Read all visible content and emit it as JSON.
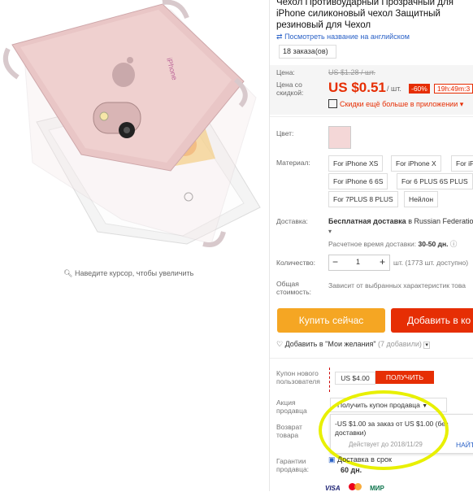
{
  "product": {
    "zoom_hint": "Наведите курсор, чтобы увеличить",
    "title": "Чехол Противоударный Прозрачный для iPhone силиконовый чехол Защитный резиновый для Чехол",
    "translate_link": "Посмотреть название на английском",
    "orders": "18 заказа(ов)"
  },
  "price": {
    "label_price": "Цена:",
    "label_discount_price": "Цена со скидкой:",
    "old_price": "US $1.28 / шт.",
    "current_price": "US $0.51",
    "unit": "/ шт.",
    "discount": "-60%",
    "timer": "19h:49m:3",
    "app_discount": "Скидки ещё больше в приложении"
  },
  "options": {
    "color_label": "Цвет:",
    "material_label": "Материал:",
    "materials": [
      "For iPhone XS",
      "For iPhone X",
      "For iP",
      "For iPhone 6 6S",
      "For 6 PLUS 6S PLUS",
      "For 7PLUS 8 PLUS",
      "Нейлон"
    ]
  },
  "shipping": {
    "label": "Доставка:",
    "free": "Бесплатная доставка",
    "to": "в Russian Federatio",
    "time_label": "Расчетное время доставки:",
    "time": "30-50 дн."
  },
  "quantity": {
    "label": "Количество:",
    "value": "1",
    "minus": "−",
    "plus": "+",
    "available": "шт. (1773 шт. доступно)"
  },
  "total": {
    "label": "Общая стоимость:",
    "value": "Зависит от выбранных характеристик това"
  },
  "actions": {
    "buy_now": "Купить сейчас",
    "add_cart": "Добавить в ко",
    "wishlist": "Добавить в \"Мои желания\"",
    "wishlist_count": "(7 добавили)"
  },
  "coupons": {
    "new_user_label": "Купон нового пользователя",
    "new_user_value": "US $4.00",
    "get_button": "ПОЛУЧИТЬ",
    "seller_label": "Акция продавца",
    "seller_dropdown": "Получить купон продавца",
    "coupon_text": "-US $1.00 за заказ от US $1.00 (без доставки)",
    "coupon_valid": "Действует до 2018/11/29",
    "coupon_find": "НАЙТ",
    "return_label": "Возврат товара"
  },
  "guarantee": {
    "label": "Гарантии продавца:",
    "value": "Доставка в срок",
    "days": "60 дн."
  },
  "payment": {
    "methods": [
      "VISA",
      "MC",
      "МИР"
    ]
  },
  "colors": {
    "accent": "#e62e04",
    "orange_button": "#f5a623",
    "highlight": "#e8f000",
    "link": "#2b62c7"
  }
}
